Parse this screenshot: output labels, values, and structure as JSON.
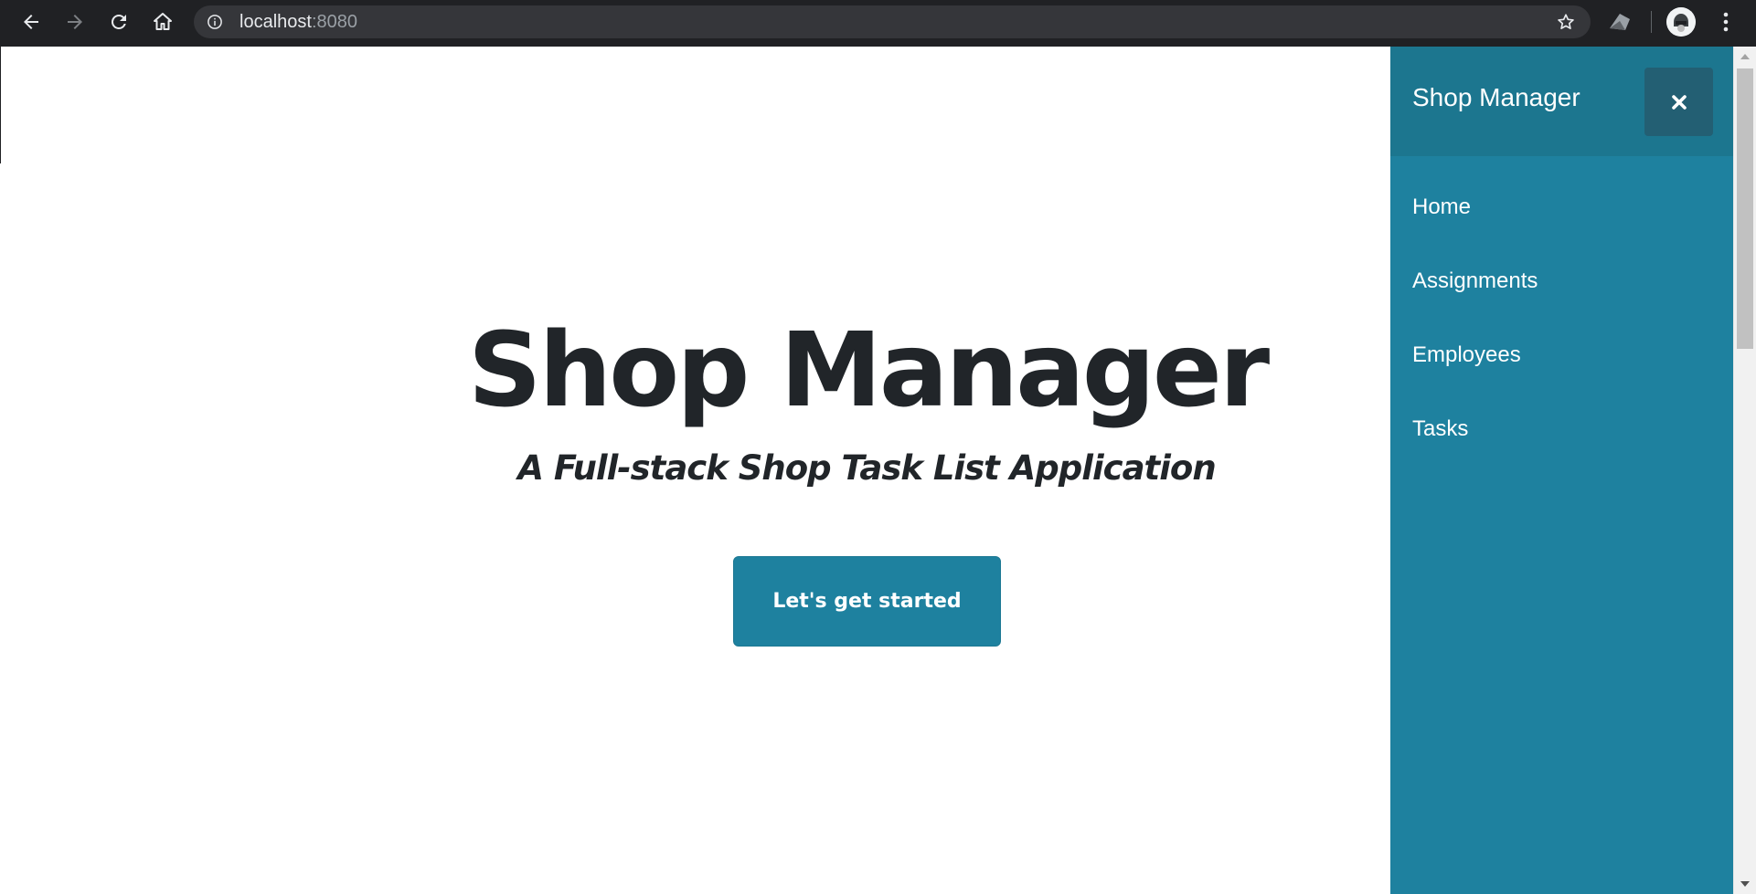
{
  "browser": {
    "url_host": "localhost",
    "url_port": ":8080",
    "icons": {
      "back": "arrow-left-icon",
      "forward": "arrow-right-icon",
      "reload": "reload-icon",
      "home": "home-icon",
      "site_info": "info-circle-icon",
      "bookmark": "star-icon",
      "extension": "extension-icon",
      "profile": "avatar",
      "menu": "kebab-menu-icon"
    }
  },
  "hero": {
    "title": "Shop Manager",
    "subtitle": "A Full-stack Shop Task List Application",
    "cta_label": "Let's get started"
  },
  "sidebar": {
    "brand": "Shop Manager",
    "close_icon": "close-icon",
    "items": [
      {
        "label": "Home"
      },
      {
        "label": "Assignments"
      },
      {
        "label": "Employees"
      },
      {
        "label": "Tasks"
      }
    ]
  },
  "colors": {
    "accent": "#1e819f",
    "sidebar_header": "#1c768f",
    "close_button": "#235f73",
    "text_dark": "#212529",
    "chrome_bg": "#202124"
  }
}
